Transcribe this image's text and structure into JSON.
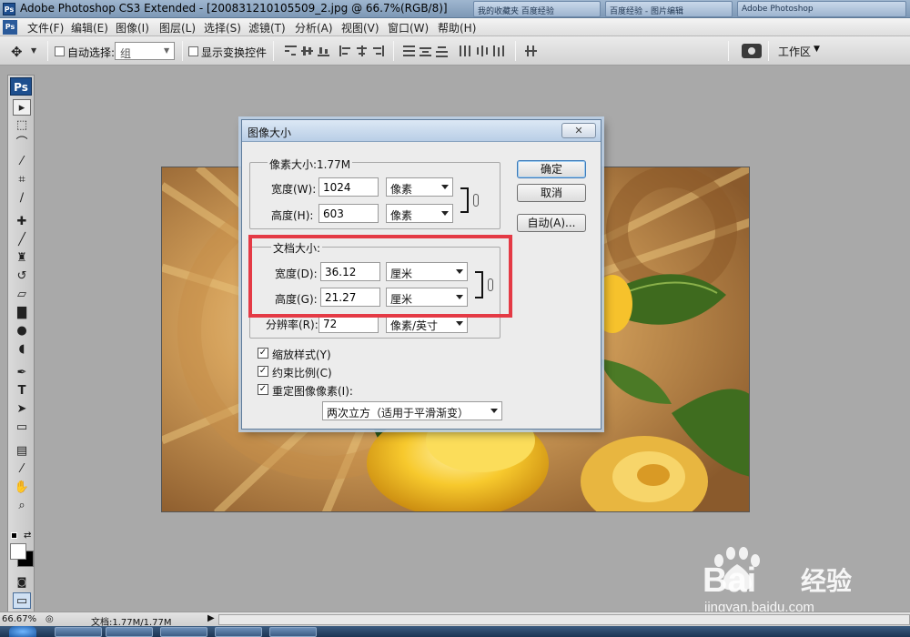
{
  "window": {
    "title": "Adobe Photoshop CS3 Extended - [200831210105509_2.jpg @ 66.7%(RGB/8)]",
    "ps_badge": "Ps",
    "taskbar_thumbs": [
      "我的收藏夹 百度经验",
      "百度经验 - 图片编辑",
      "Adobe Photoshop"
    ]
  },
  "menubar": {
    "items": [
      "文件(F)",
      "编辑(E)",
      "图像(I)",
      "图层(L)",
      "选择(S)",
      "滤镜(T)",
      "分析(A)",
      "视图(V)",
      "窗口(W)",
      "帮助(H)"
    ]
  },
  "options_bar": {
    "auto_select_label": "自动选择:",
    "auto_select_value": "组",
    "show_transform_label": "显示变换控件",
    "workspace_label": "工作区",
    "auto_select_checked": false,
    "show_transform_checked": false
  },
  "toolbox": {
    "logo": "Ps",
    "tools": [
      "move-tool",
      "marquee-tool",
      "lasso-tool",
      "magic-wand-tool",
      "crop-tool",
      "slice-tool",
      "healing-brush-tool",
      "brush-tool",
      "clone-stamp-tool",
      "history-brush-tool",
      "eraser-tool",
      "gradient-tool",
      "blur-tool",
      "dodge-tool",
      "pen-tool",
      "type-tool",
      "path-selection-tool",
      "shape-tool",
      "notes-tool",
      "eyedropper-tool",
      "hand-tool",
      "zoom-tool"
    ]
  },
  "dialog": {
    "title": "图像大小",
    "pixel_group_label": "像素大小:1.77M",
    "width_label": "宽度(W):",
    "width_value": "1024",
    "width_unit": "像素",
    "height_label": "高度(H):",
    "height_value": "603",
    "height_unit": "像素",
    "doc_group_label": "文档大小:",
    "doc_width_label": "宽度(D):",
    "doc_width_value": "36.12",
    "doc_width_unit": "厘米",
    "doc_height_label": "高度(G):",
    "doc_height_value": "21.27",
    "doc_height_unit": "厘米",
    "resolution_label": "分辨率(R):",
    "resolution_value": "72",
    "resolution_unit": "像素/英寸",
    "ok_button": "确定",
    "cancel_button": "取消",
    "auto_button": "自动(A)...",
    "scale_styles_label": "缩放样式(Y)",
    "scale_styles_checked": true,
    "constrain_label": "约束比例(C)",
    "constrain_checked": true,
    "resample_label": "重定图像像素(I):",
    "resample_checked": true,
    "resample_method": "两次立方（适用于平滑渐变）"
  },
  "status_bar": {
    "zoom": "66.67%",
    "doc_info": "文档:1.77M/1.77M"
  },
  "watermark": {
    "brand": "Bai",
    "brand_cn": "经验",
    "url": "jingyan.baidu.com"
  },
  "colors": {
    "highlight_border": "#e43a45",
    "dialog_bg": "#ececec",
    "workspace_bg": "#a9a9a9"
  }
}
